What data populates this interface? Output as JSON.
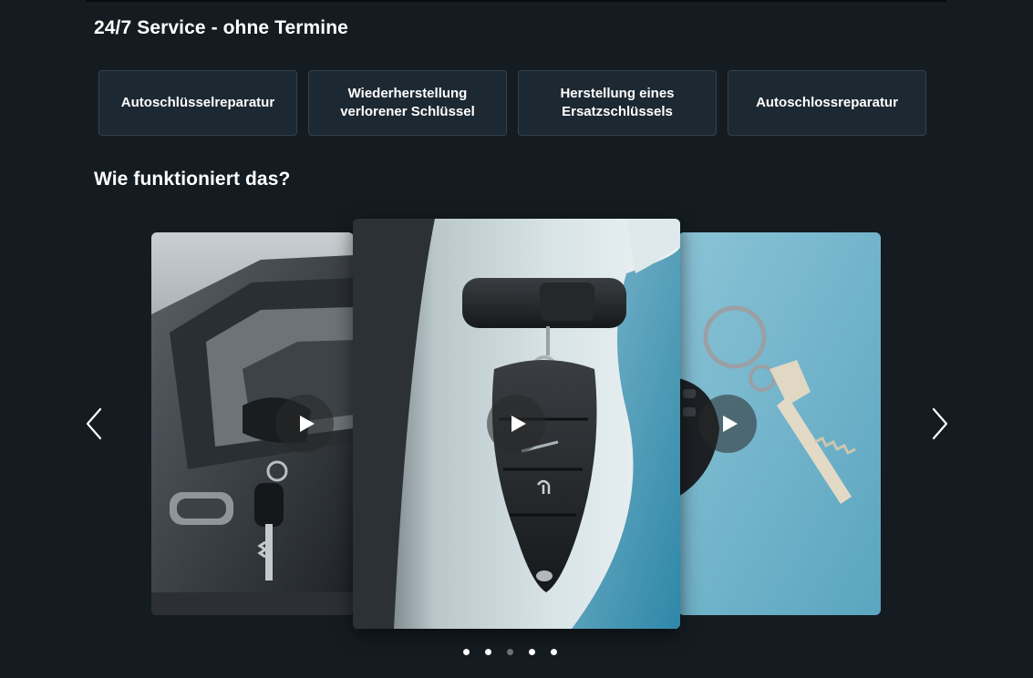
{
  "service_section": {
    "title": "24/7 Service - ohne Termine",
    "cards": [
      {
        "label": "Autoschlüsselreparatur"
      },
      {
        "label": "Wiederherstellung verlorener Schlüssel"
      },
      {
        "label": "Herstellung eines Ersatzschlüssels"
      },
      {
        "label": "Autoschlossreparatur"
      }
    ]
  },
  "how_section": {
    "title": "Wie funktioniert das?"
  },
  "carousel": {
    "slides": [
      {
        "subject": "car door with keys in lock",
        "icon": "play-icon"
      },
      {
        "subject": "car key fob hanging from door",
        "icon": "play-icon"
      },
      {
        "subject": "keys with remote on blue surface",
        "icon": "play-icon"
      }
    ],
    "prev_icon": "chevron-left-icon",
    "next_icon": "chevron-right-icon",
    "dot_count": 5,
    "active_dot": 3
  },
  "colors": {
    "background": "#141c22",
    "card_background": "#1c2832",
    "card_border": "#34424d",
    "text": "#ffffff"
  }
}
